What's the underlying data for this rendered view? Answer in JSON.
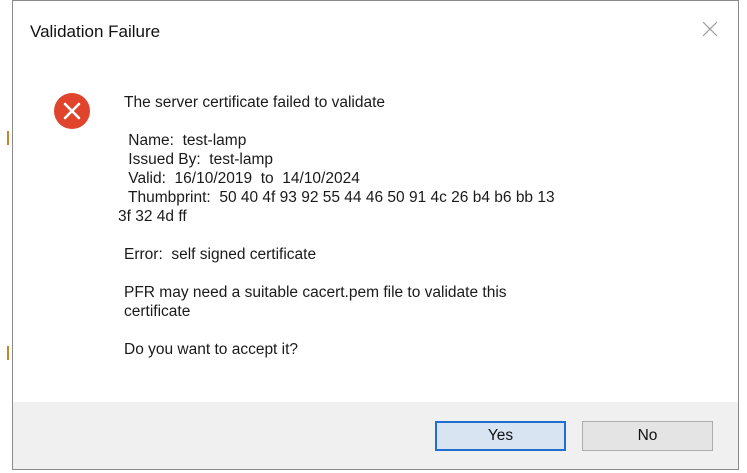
{
  "dialog": {
    "title": "Validation Failure",
    "close_icon": "close-icon",
    "error_icon": "error-icon",
    "colors": {
      "error_red": "#e0442c",
      "primary_border": "#1f6fce",
      "footer_bg": "#f0f0f0"
    },
    "message": {
      "heading": "The server certificate failed to validate",
      "name": " Name:  test-lamp",
      "issued_by": " Issued By:  test-lamp",
      "valid": " Valid:  16/10/2019  to  14/10/2024",
      "thumbprint_line1": " Thumbprint:  50 40 4f 93 92 55 44 46 50 91 4c 26 b4 b6 bb 13",
      "thumbprint_line2": "3f 32 4d ff",
      "error": "Error:  self signed certificate",
      "hint_line1": "PFR may need a suitable cacert.pem file to validate this",
      "hint_line2": "certificate",
      "question": "Do you want to accept it?"
    },
    "buttons": {
      "yes": "Yes",
      "no": "No"
    }
  }
}
